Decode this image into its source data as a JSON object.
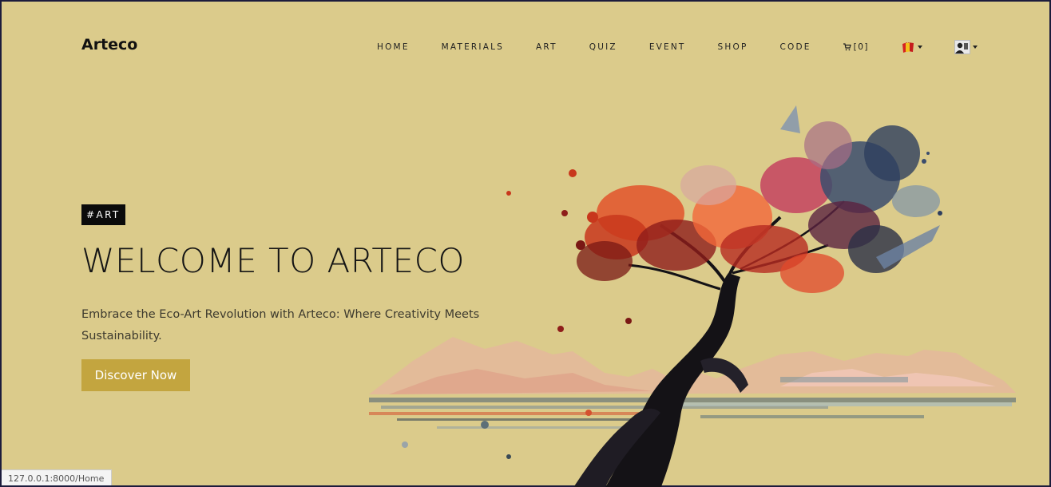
{
  "brand": "Arteco",
  "nav": {
    "items": [
      "HOME",
      "MATERIALS",
      "ART",
      "QUIZ",
      "EVENT",
      "SHOP",
      "CODE"
    ],
    "cart_label": "[0]",
    "cart_icon": "cart-icon",
    "language_icon": "language-flag-icon",
    "user_icon": "user-avatar-icon"
  },
  "hero": {
    "tag": "#ART",
    "title": "WELCOME TO ARTECO",
    "subtitle": "Embrace the Eco-Art Revolution with Arteco: Where Creativity Meets Sustainability.",
    "cta_label": "Discover Now",
    "image": "watercolor-tree-illustration"
  },
  "status_bar": {
    "url": "127.0.0.1:8000/Home"
  },
  "colors": {
    "background": "#dbcb8b",
    "accent": "#c3a53f",
    "tag_bg": "#0b0b0b"
  }
}
